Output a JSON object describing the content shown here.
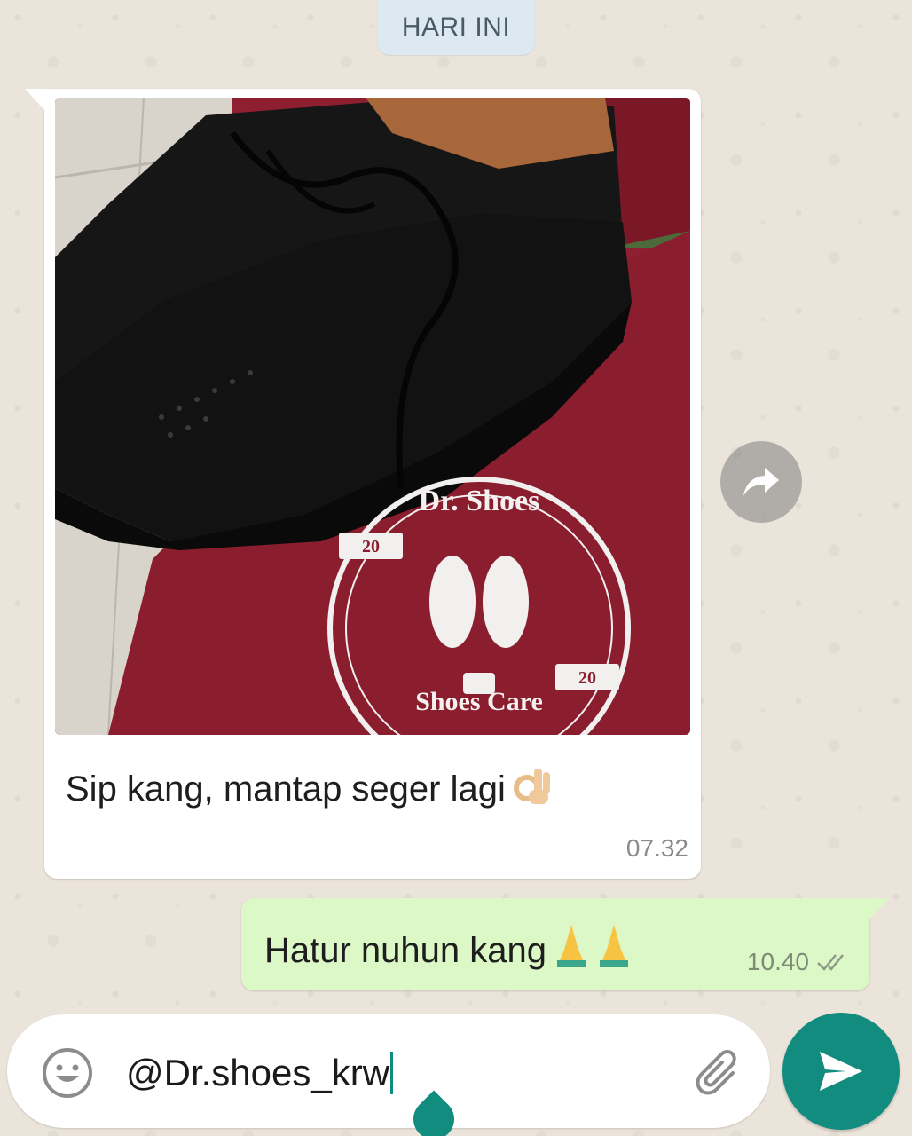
{
  "date_divider": "HARI INI",
  "incoming": {
    "caption": "Sip kang, mantap seger lagi",
    "caption_emoji": "ok-hand-emoji",
    "time": "07.32",
    "photo": {
      "logo_top_text": "Dr. Shoes",
      "logo_bottom_text": "Shoes Care",
      "logo_year_left": "20",
      "logo_year_right": "20"
    }
  },
  "forward_icon": "share-arrow-icon",
  "outgoing": {
    "text": "Hatur nuhun kang",
    "emoji": "folded-hands-emoji",
    "time": "10.40",
    "status_icon": "double-check-icon"
  },
  "composer": {
    "value": "@Dr.shoes_krw",
    "emoji_icon": "smiley-icon",
    "attach_icon": "paperclip-icon",
    "send_icon": "send-icon"
  },
  "colors": {
    "send_button": "#128c7e",
    "outgoing_bubble": "#dcf8c6",
    "incoming_bubble": "#ffffff",
    "date_chip": "#dde9f1",
    "bag_maroon": "#8a1e2e"
  }
}
